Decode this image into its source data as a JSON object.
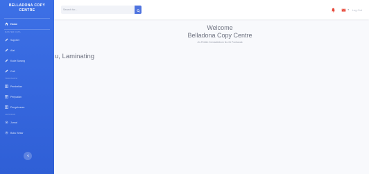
{
  "brand": {
    "line1": "BELLADONA COPY",
    "line2": "CENTRE"
  },
  "sidebar": {
    "items": [
      {
        "label": "Home",
        "icon": "home-icon",
        "active": true
      },
      {
        "section": "MASTER DATA"
      },
      {
        "label": "Supplier",
        "icon": "pencil-icon"
      },
      {
        "label": "Alat",
        "icon": "pencil-icon"
      },
      {
        "label": "Kode Barang",
        "icon": "pencil-icon"
      },
      {
        "label": "Cuti",
        "icon": "pencil-icon"
      },
      {
        "section": "TRANSAKSI"
      },
      {
        "label": "Pembelian",
        "icon": "table-icon"
      },
      {
        "label": "Penjualan",
        "icon": "table-icon"
      },
      {
        "label": "Pengeluaran",
        "icon": "table-icon"
      },
      {
        "section": "LAPORAN"
      },
      {
        "label": "Jurnal",
        "icon": "gear-icon"
      },
      {
        "label": "Buku Besar",
        "icon": "gear-icon"
      }
    ],
    "toggle_icon": "chevron-left-icon"
  },
  "topbar": {
    "search_placeholder": "Search for...",
    "logout_label": "Log Out"
  },
  "main": {
    "welcome": "Welcome",
    "company": "Belladona Copy Centre",
    "tagline": "Jln.Pekitin Kemantikbom No.31 Pontianak",
    "marquee": "u, Laminating"
  },
  "colors": {
    "sidebar": "#3d70e6",
    "accent": "#4e73df",
    "alert": "#e74a3b",
    "text": "#6e7280",
    "background": "#f8f9fc"
  }
}
